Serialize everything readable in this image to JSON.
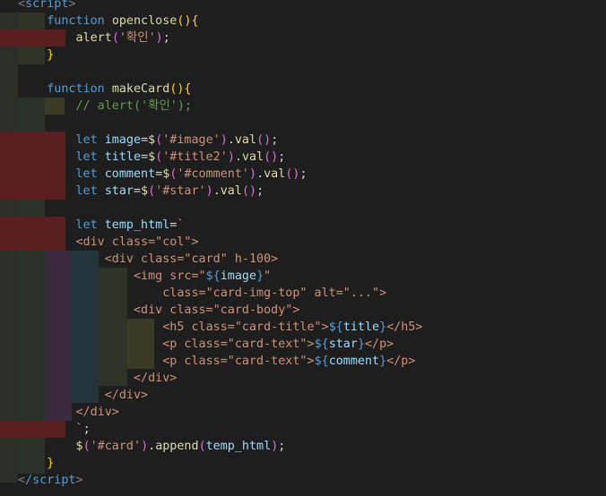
{
  "editor": {
    "lines": [
      [
        {
          "t": "<",
          "c": "ang"
        },
        {
          "t": "script",
          "c": "tag"
        },
        {
          "t": ">",
          "c": "ang"
        }
      ],
      [
        {
          "t": "    "
        },
        {
          "t": "function",
          "c": "kw"
        },
        {
          "t": " "
        },
        {
          "t": "openclose",
          "c": "fn"
        },
        {
          "t": "(){",
          "c": "br1"
        }
      ],
      [
        {
          "t": "        "
        },
        {
          "t": "alert",
          "c": "fn"
        },
        {
          "t": "(",
          "c": "br2"
        },
        {
          "t": "'확인'",
          "c": "str"
        },
        {
          "t": ")",
          "c": "br2"
        },
        {
          "t": ";"
        }
      ],
      [
        {
          "t": "    "
        },
        {
          "t": "}",
          "c": "br1"
        }
      ],
      [],
      [
        {
          "t": "    "
        },
        {
          "t": "function",
          "c": "kw"
        },
        {
          "t": " "
        },
        {
          "t": "makeCard",
          "c": "fn"
        },
        {
          "t": "(){",
          "c": "br1"
        }
      ],
      [
        {
          "t": "        "
        },
        {
          "t": "// alert('확인');",
          "c": "com"
        }
      ],
      [],
      [
        {
          "t": "        "
        },
        {
          "t": "let",
          "c": "kw"
        },
        {
          "t": " "
        },
        {
          "t": "image",
          "c": "var"
        },
        {
          "t": "="
        },
        {
          "t": "$",
          "c": "fn"
        },
        {
          "t": "(",
          "c": "br2"
        },
        {
          "t": "'#image'",
          "c": "str"
        },
        {
          "t": ")",
          "c": "br2"
        },
        {
          "t": "."
        },
        {
          "t": "val",
          "c": "fn"
        },
        {
          "t": "()",
          "c": "br2"
        },
        {
          "t": ";"
        }
      ],
      [
        {
          "t": "        "
        },
        {
          "t": "let",
          "c": "kw"
        },
        {
          "t": " "
        },
        {
          "t": "title",
          "c": "var"
        },
        {
          "t": "="
        },
        {
          "t": "$",
          "c": "fn"
        },
        {
          "t": "(",
          "c": "br2"
        },
        {
          "t": "'#title2'",
          "c": "str"
        },
        {
          "t": ")",
          "c": "br2"
        },
        {
          "t": "."
        },
        {
          "t": "val",
          "c": "fn"
        },
        {
          "t": "()",
          "c": "br2"
        },
        {
          "t": ";"
        }
      ],
      [
        {
          "t": "        "
        },
        {
          "t": "let",
          "c": "kw"
        },
        {
          "t": " "
        },
        {
          "t": "comment",
          "c": "var"
        },
        {
          "t": "="
        },
        {
          "t": "$",
          "c": "fn"
        },
        {
          "t": "(",
          "c": "br2"
        },
        {
          "t": "'#comment'",
          "c": "str"
        },
        {
          "t": ")",
          "c": "br2"
        },
        {
          "t": "."
        },
        {
          "t": "val",
          "c": "fn"
        },
        {
          "t": "()",
          "c": "br2"
        },
        {
          "t": ";"
        }
      ],
      [
        {
          "t": "        "
        },
        {
          "t": "let",
          "c": "kw"
        },
        {
          "t": " "
        },
        {
          "t": "star",
          "c": "var"
        },
        {
          "t": "="
        },
        {
          "t": "$",
          "c": "fn"
        },
        {
          "t": "(",
          "c": "br2"
        },
        {
          "t": "'#star'",
          "c": "str"
        },
        {
          "t": ")",
          "c": "br2"
        },
        {
          "t": "."
        },
        {
          "t": "val",
          "c": "fn"
        },
        {
          "t": "()",
          "c": "br2"
        },
        {
          "t": ";"
        }
      ],
      [],
      [
        {
          "t": "        "
        },
        {
          "t": "let",
          "c": "kw"
        },
        {
          "t": " "
        },
        {
          "t": "temp_html",
          "c": "var"
        },
        {
          "t": "="
        },
        {
          "t": "`",
          "c": "tpl"
        }
      ],
      [
        {
          "t": "        "
        },
        {
          "t": "<div class=\"col\">",
          "c": "tpl"
        }
      ],
      [
        {
          "t": "            "
        },
        {
          "t": "<div class=\"card\" h-100>",
          "c": "tpl"
        }
      ],
      [
        {
          "t": "                "
        },
        {
          "t": "<img src=\"",
          "c": "tpl"
        },
        {
          "t": "${",
          "c": "dl"
        },
        {
          "t": "image",
          "c": "var"
        },
        {
          "t": "}",
          "c": "dl"
        },
        {
          "t": "\"",
          "c": "tpl"
        }
      ],
      [
        {
          "t": "                    "
        },
        {
          "t": "class=\"card-img-top\" alt=\"...\">",
          "c": "tpl"
        }
      ],
      [
        {
          "t": "                "
        },
        {
          "t": "<div class=\"card-body\">",
          "c": "tpl"
        }
      ],
      [
        {
          "t": "                    "
        },
        {
          "t": "<h5 class=\"card-title\">",
          "c": "tpl"
        },
        {
          "t": "${",
          "c": "dl"
        },
        {
          "t": "title",
          "c": "var"
        },
        {
          "t": "}",
          "c": "dl"
        },
        {
          "t": "</h5>",
          "c": "tpl"
        }
      ],
      [
        {
          "t": "                    "
        },
        {
          "t": "<p class=\"card-text\">",
          "c": "tpl"
        },
        {
          "t": "${",
          "c": "dl"
        },
        {
          "t": "star",
          "c": "var"
        },
        {
          "t": "}",
          "c": "dl"
        },
        {
          "t": "</p>",
          "c": "tpl"
        }
      ],
      [
        {
          "t": "                    "
        },
        {
          "t": "<p class=\"card-text\">",
          "c": "tpl"
        },
        {
          "t": "${",
          "c": "dl"
        },
        {
          "t": "comment",
          "c": "var"
        },
        {
          "t": "}",
          "c": "dl"
        },
        {
          "t": "</p>",
          "c": "tpl"
        }
      ],
      [
        {
          "t": "                "
        },
        {
          "t": "</div>",
          "c": "tpl"
        }
      ],
      [
        {
          "t": "            "
        },
        {
          "t": "</div>",
          "c": "tpl"
        }
      ],
      [
        {
          "t": "        "
        },
        {
          "t": "</div>",
          "c": "tpl"
        }
      ],
      [
        {
          "t": "        "
        },
        {
          "t": "`",
          "c": "tpl"
        },
        {
          "t": ";"
        }
      ],
      [
        {
          "t": "        "
        },
        {
          "t": "$",
          "c": "fn"
        },
        {
          "t": "(",
          "c": "br2"
        },
        {
          "t": "'#card'",
          "c": "str"
        },
        {
          "t": ")",
          "c": "br2"
        },
        {
          "t": "."
        },
        {
          "t": "append",
          "c": "fn"
        },
        {
          "t": "(",
          "c": "br2"
        },
        {
          "t": "temp_html",
          "c": "var"
        },
        {
          "t": ")",
          "c": "br2"
        },
        {
          "t": ";"
        }
      ],
      [
        {
          "t": "    "
        },
        {
          "t": "}",
          "c": "br1"
        }
      ],
      [
        {
          "t": "<",
          "c": "ang"
        },
        {
          "t": "/script",
          "c": "tag"
        },
        {
          "t": ">",
          "c": "ang"
        }
      ]
    ]
  }
}
